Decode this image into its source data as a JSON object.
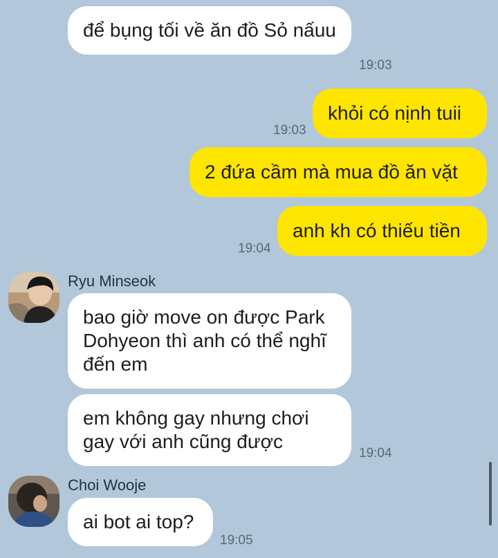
{
  "messages": [
    {
      "sender": "them",
      "text": "để bụng tối về ăn đồ Sỏ nấuu",
      "time": "19:03"
    },
    {
      "sender": "me",
      "text": "khỏi có nịnh tuii",
      "time": "19:03"
    },
    {
      "sender": "me",
      "text": "2 đứa cầm mà mua đồ ăn vặt",
      "time": ""
    },
    {
      "sender": "me",
      "text": "anh kh có thiếu tiền",
      "time": "19:04"
    },
    {
      "sender": "Ryu Minseok",
      "text": "bao giờ move on được Park Dohyeon thì anh có thể nghĩ đến em",
      "time": ""
    },
    {
      "sender": "Ryu Minseok",
      "text": "em không gay nhưng chơi gay với anh cũng được",
      "time": "19:04"
    },
    {
      "sender": "Choi Wooje",
      "text": "ai bot ai top?",
      "time": "19:05"
    }
  ],
  "contacts": {
    "minseok": {
      "name": "Ryu Minseok",
      "avatar_icon": "profile-photo-icon"
    },
    "wooje": {
      "name": "Choi Wooje",
      "avatar_icon": "profile-photo-icon"
    }
  },
  "colors": {
    "background": "#b2c7da",
    "incoming": "#ffffff",
    "outgoing": "#fee500",
    "time": "#57687a"
  }
}
